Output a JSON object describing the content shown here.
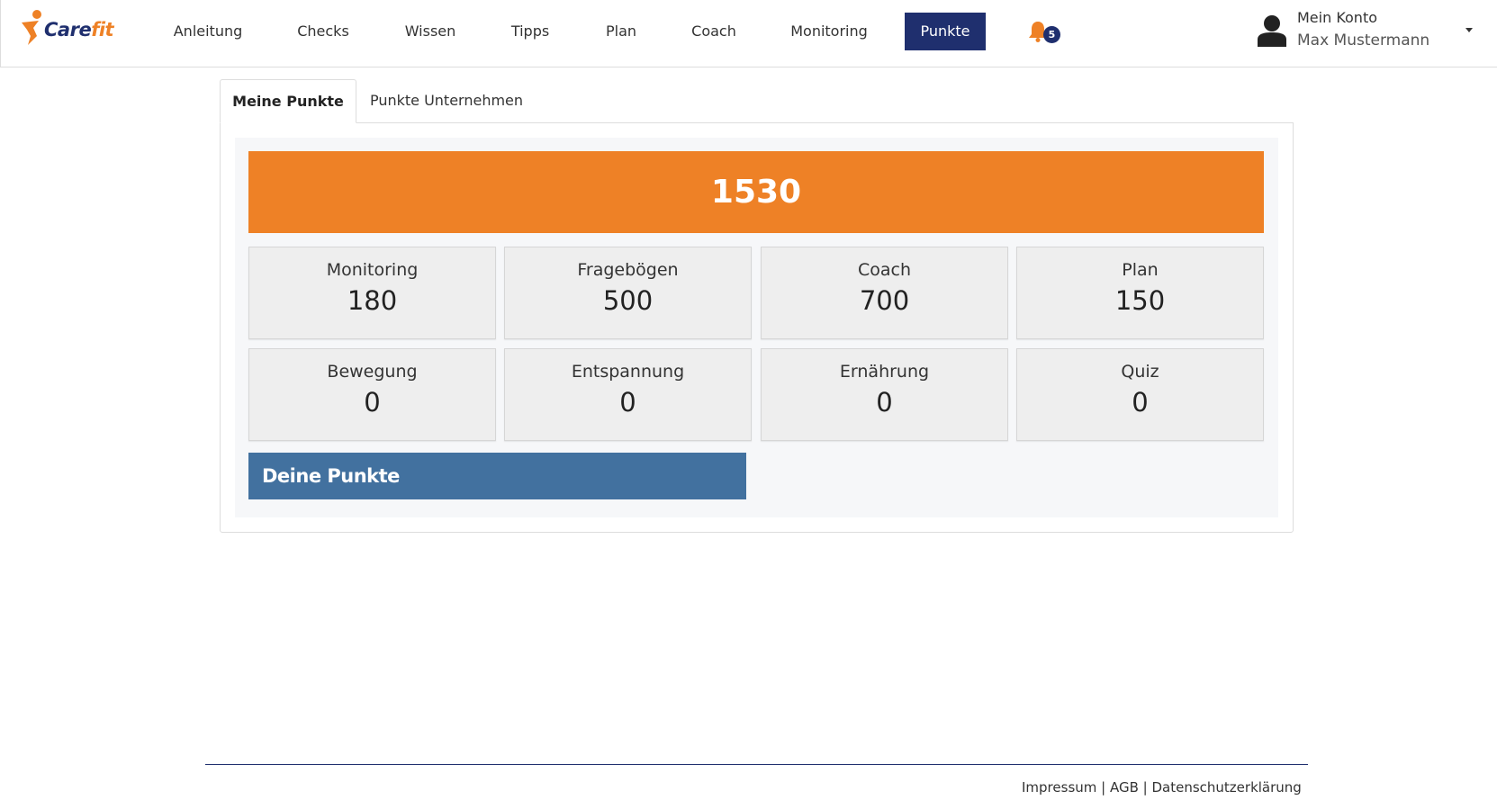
{
  "brand": {
    "name_part1": "Care",
    "name_part2": "fit",
    "primary_color": "#1f2f6e",
    "accent_color": "#ee8126"
  },
  "nav": {
    "items": [
      {
        "label": "Anleitung"
      },
      {
        "label": "Checks"
      },
      {
        "label": "Wissen"
      },
      {
        "label": "Tipps"
      },
      {
        "label": "Plan"
      },
      {
        "label": "Coach"
      },
      {
        "label": "Monitoring"
      },
      {
        "label": "Punkte",
        "active": true
      }
    ],
    "notifications": {
      "icon": "bell-icon",
      "count": "5"
    }
  },
  "account": {
    "label": "Mein Konto",
    "name": "Max Mustermann",
    "icon": "user-icon"
  },
  "tabs": [
    {
      "label": "Meine Punkte",
      "active": true
    },
    {
      "label": "Punkte Unternehmen",
      "active": false
    }
  ],
  "points": {
    "total": "1530",
    "total_color": "#ee8126",
    "categories": [
      {
        "label": "Monitoring",
        "value": "180"
      },
      {
        "label": "Fragebögen",
        "value": "500"
      },
      {
        "label": "Coach",
        "value": "700"
      },
      {
        "label": "Plan",
        "value": "150"
      },
      {
        "label": "Bewegung",
        "value": "0"
      },
      {
        "label": "Entspannung",
        "value": "0"
      },
      {
        "label": "Ernährung",
        "value": "0"
      },
      {
        "label": "Quiz",
        "value": "0"
      }
    ],
    "section_title": "Deine Punkte",
    "section_color": "#42719f"
  },
  "footer": {
    "links": [
      {
        "label": "Impressum"
      },
      {
        "label": "AGB"
      },
      {
        "label": "Datenschutzerklärung"
      }
    ],
    "separator": " | "
  }
}
